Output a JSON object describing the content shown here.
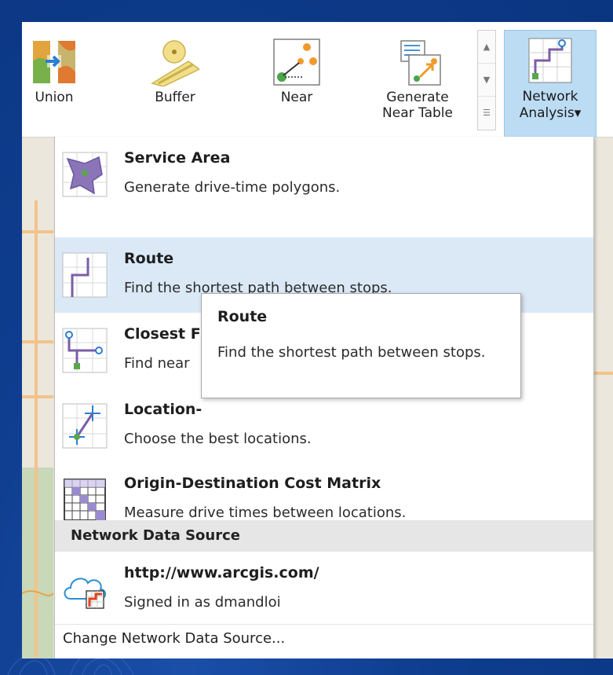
{
  "ribbon": {
    "tools": [
      {
        "label": "Union",
        "icon": "union-icon"
      },
      {
        "label": "Buffer",
        "icon": "buffer-icon"
      },
      {
        "label": "Near",
        "icon": "near-icon"
      },
      {
        "label_line1": "Generate",
        "label_line2": "Near Table",
        "icon": "generate-near-table-icon"
      }
    ],
    "network_analysis": {
      "label_line1": "Network",
      "label_line2": "Analysis",
      "dropdown": "▾",
      "icon": "network-analysis-icon"
    },
    "scroll": {
      "up": "▲",
      "down": "▼",
      "more": "☰"
    }
  },
  "menu": {
    "items": [
      {
        "title": "Service Area",
        "desc": "Generate drive-time polygons.",
        "icon": "service-area-icon"
      },
      {
        "title": "Route",
        "desc": "Find the shortest path between stops.",
        "icon": "route-icon"
      },
      {
        "title": "Closest F",
        "desc": "Find near",
        "icon": "closest-facility-icon"
      },
      {
        "title": "Location-",
        "desc": "Choose the best locations.",
        "icon": "location-allocation-icon"
      },
      {
        "title": "Origin-Destination Cost Matrix",
        "desc": "Measure drive times between locations.",
        "icon": "od-cost-matrix-icon"
      }
    ],
    "section_header": "Network Data Source",
    "source": {
      "title": "http://www.arcgis.com/",
      "desc": "Signed in as dmandloi",
      "icon": "arcgis-cloud-icon"
    },
    "change_link": "Change Network Data Source..."
  },
  "tooltip": {
    "title": "Route",
    "body": "Find the shortest path between stops."
  },
  "colors": {
    "hover": "#dbe9f7",
    "accent": "#bcdcf4",
    "route_purple": "#7b5ea7",
    "green": "#5aa64a"
  }
}
